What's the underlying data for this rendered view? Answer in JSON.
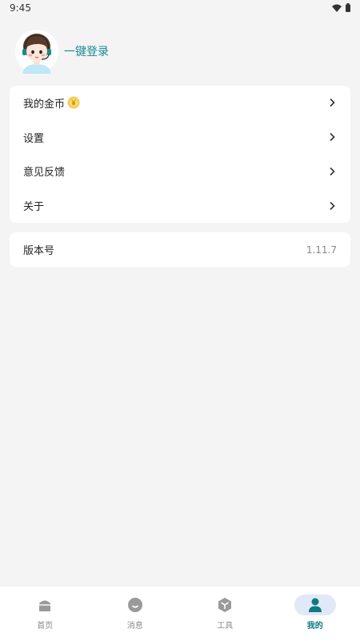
{
  "status_bar": {
    "time": "9:45"
  },
  "profile": {
    "login_text": "一键登录"
  },
  "menu": {
    "items": [
      {
        "label": "我的金币"
      },
      {
        "label": "设置"
      },
      {
        "label": "意见反馈"
      },
      {
        "label": "关于"
      }
    ]
  },
  "version": {
    "label": "版本号",
    "value": "1.11.7"
  },
  "bottom_nav": {
    "items": [
      {
        "label": "首页",
        "icon": "home-icon"
      },
      {
        "label": "消息",
        "icon": "message-icon"
      },
      {
        "label": "工具",
        "icon": "tools-icon"
      },
      {
        "label": "我的",
        "icon": "profile-icon"
      }
    ],
    "active_index": 3
  },
  "colors": {
    "accent": "#0e7b80",
    "link": "#1a8a8f",
    "background": "#f4f4f4",
    "active_pill": "#e1e8f7",
    "coin": "#f6c84a"
  }
}
